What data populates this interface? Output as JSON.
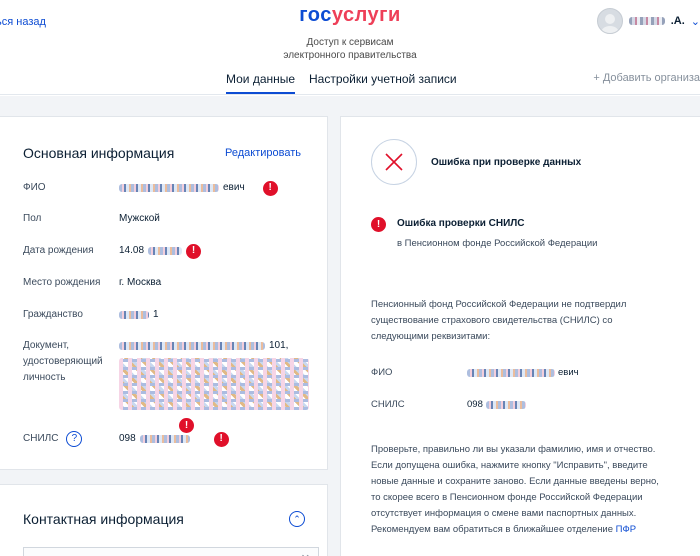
{
  "header": {
    "back_link": "ься назад",
    "logo_gos": "гос",
    "logo_uslugi": "услуги",
    "subtitle_line1": "Доступ к сервисам",
    "subtitle_line2": "электронного правительства",
    "user_initial": ".А.",
    "user_chevron": "⌄"
  },
  "tabs": {
    "my_data": "Мои данные",
    "account_settings": "Настройки учетной записи",
    "add_org": "+ Добавить организа"
  },
  "main_card": {
    "title": "Основная информация",
    "edit": "Редактировать",
    "fio_label": "ФИО",
    "fio_suffix": "евич",
    "gender_label": "Пол",
    "gender_value": "Мужской",
    "birth_date_label": "Дата рождения",
    "birth_date_value": "14.08",
    "birth_place_label": "Место рождения",
    "birth_place_value": "г. Москва",
    "citizenship_label": "Гражданство",
    "citizenship_suffix": "1",
    "document_label_1": "Документ,",
    "document_label_2": "удостоверяющий",
    "document_label_3": "личность",
    "document_value": "101,",
    "snils_label": "СНИЛС",
    "snils_help": "?",
    "snils_value": "098",
    "error_mark": "!"
  },
  "contact_card": {
    "title": "Контактная информация",
    "collapse": "⌃",
    "close": "✕"
  },
  "error_card": {
    "header": "Ошибка при проверке данных",
    "snils_error_title": "Ошибка проверки СНИЛС",
    "snils_error_sub": "в Пенсионном фонде Российской Федерации",
    "pfr_text": "Пенсионный фонд Российской Федерации не подтвердил существование страхового свидетельства (СНИЛС) со следующими реквизитами:",
    "fio_label": "ФИО",
    "fio_suffix": "евич",
    "snils_label": "СНИЛС",
    "snils_value": "098",
    "advice": "Проверьте, правильно ли вы указали фамилию, имя и отчество. Если допущена ошибка, нажмите кнопку \"Исправить\", введите новые данные и сохраните заново. Если данные введены верно, то скорее всего в Пенсионном фонде Российской Федерации отсутствует информация о смене вами паспортных данных. Рекомендуем вам обратиться в ближайшее отделение",
    "advice_link": "ПФР"
  },
  "colors": {
    "brand_blue": "#0d4cd3",
    "brand_red": "#ee3f58",
    "error_red": "#e0102a"
  }
}
